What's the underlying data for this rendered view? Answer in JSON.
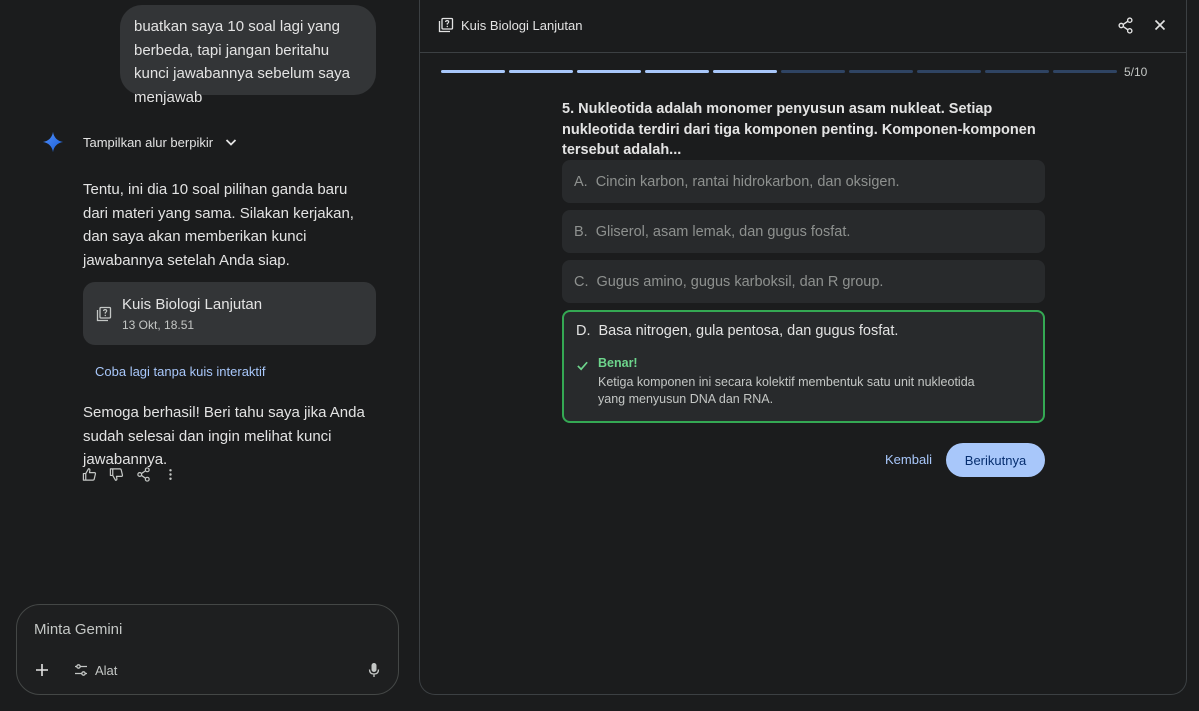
{
  "chat": {
    "user_message": "buatkan saya 10 soal lagi yang berbeda, tapi jangan beritahu kunci jawabannya sebelum saya menjawab",
    "thinking_label": "Tampilkan alur berpikir",
    "reply_intro": "Tentu, ini dia 10 soal pilihan ganda baru dari materi yang sama. Silakan kerjakan, dan saya akan memberikan kunci jawabannya setelah Anda siap.",
    "quiz_card": {
      "title": "Kuis Biologi Lanjutan",
      "date": "13 Okt, 18.51",
      "icon": "quiz-icon"
    },
    "retry_link": "Coba lagi tanpa kuis interaktif",
    "reply_outro": "Semoga berhasil! Beri tahu saya jika Anda sudah selesai dan ingin melihat kunci jawabannya.",
    "actions": [
      "thumbs-up-icon",
      "thumbs-down-icon",
      "share-icon",
      "more-icon"
    ]
  },
  "input": {
    "placeholder": "Minta Gemini",
    "tools_label": "Alat"
  },
  "quiz": {
    "title": "Kuis Biologi Lanjutan",
    "progress": {
      "current": 5,
      "total": 10,
      "label": "5/10"
    },
    "question": "5. Nukleotida adalah monomer penyusun asam nukleat. Setiap nukleotida terdiri dari tiga komponen penting. Komponen-komponen tersebut adalah...",
    "options": [
      {
        "letter": "A.",
        "text": "Cincin karbon, rantai hidrokarbon, dan oksigen."
      },
      {
        "letter": "B.",
        "text": "Gliserol, asam lemak, dan gugus fosfat."
      },
      {
        "letter": "C.",
        "text": "Gugus amino, gugus karboksil, dan R group."
      },
      {
        "letter": "D.",
        "text": "Basa nitrogen, gula pentosa, dan gugus fosfat."
      }
    ],
    "feedback": {
      "label": "Benar!",
      "text": "Ketiga komponen ini secara kolektif membentuk satu unit nukleotida yang menyusun DNA dan RNA."
    },
    "back_label": "Kembali",
    "next_label": "Berikutnya"
  },
  "colors": {
    "accent": "#a8c7fa",
    "correct": "#34a853",
    "background": "#1b1c1d"
  }
}
